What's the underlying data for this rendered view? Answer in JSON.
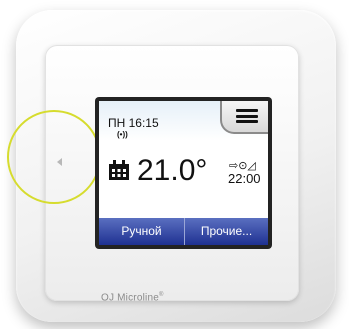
{
  "device": {
    "brand": "OJ Microline",
    "brand_mark": "®"
  },
  "screen": {
    "day_time": "ПН 16:15",
    "wifi_symbol": "(•))",
    "temperature": "21.0°",
    "schedule_time": "22:00",
    "schedule_icons": "⇨⊙◿",
    "menu_icon": "menu-icon"
  },
  "buttons": {
    "manual": "Ручной",
    "other": "Прочие..."
  },
  "colors": {
    "button_blue": "#1f3192",
    "highlight": "#d6dc2e"
  }
}
